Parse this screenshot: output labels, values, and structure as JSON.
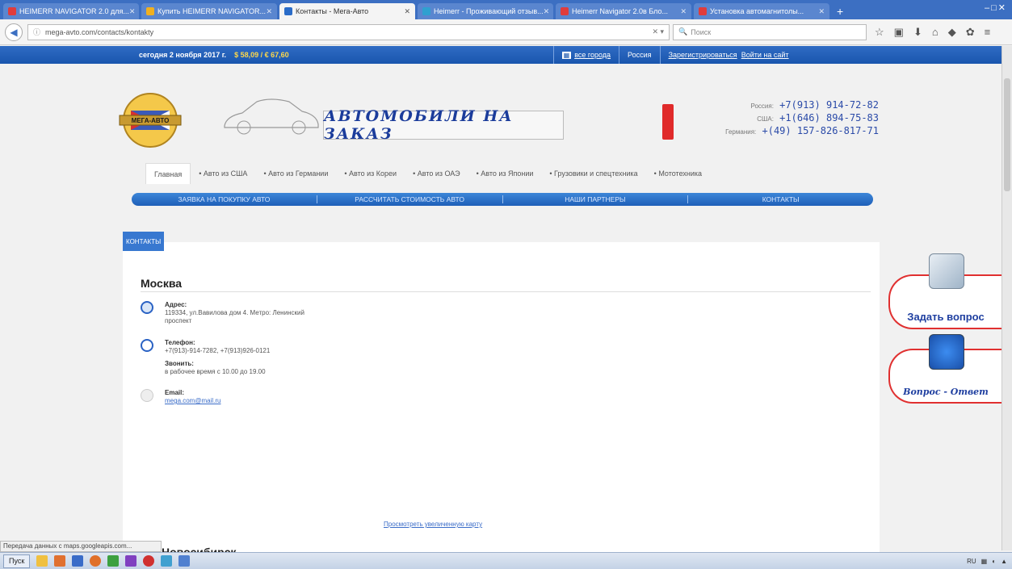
{
  "browser": {
    "tabs": [
      {
        "label": "HEIMERR NAVIGATOR 2.0 для...",
        "color": "#e03c3c",
        "active": false
      },
      {
        "label": "Купить HEIMERR NAVIGATOR...",
        "color": "#f0b020",
        "active": false
      },
      {
        "label": "Контакты - Мега-Авто",
        "color": "#2a6cc8",
        "active": true
      },
      {
        "label": "Heimerr - Проживающий отзыв...",
        "color": "#2fa0d0",
        "active": false
      },
      {
        "label": "Heimerr Navigator 2.0в Бло...",
        "color": "#e03c3c",
        "active": false
      },
      {
        "label": "Установка автомагнитолы...",
        "color": "#e03c3c",
        "active": false
      }
    ],
    "new_tab": "+",
    "url": "mega-avto.com/contacts/kontakty",
    "search_placeholder": "Поиск"
  },
  "sitebar": {
    "date": "сегодня 2 ноября 2017 г.",
    "rates": "$ 58,09 / € 67,60",
    "map_link": "все города",
    "region": "Россия",
    "register": "Зарегистрироваться",
    "login": "Войти на сайт"
  },
  "header": {
    "logo_text": "МЕГА-АВТО",
    "slogan": "АВТОМОБИЛИ НА ЗАКАЗ",
    "phones": [
      {
        "label": "Россия:",
        "number": "+7(913) 914-72-82"
      },
      {
        "label": "США:",
        "number": "+1(646) 894-75-83"
      },
      {
        "label": "Германия:",
        "number": "+(49) 157-826-817-71"
      }
    ]
  },
  "menu": [
    {
      "label": "Главная",
      "active": true
    },
    {
      "label": "• Авто из США",
      "active": false
    },
    {
      "label": "• Авто из Германии",
      "active": false
    },
    {
      "label": "• Авто из Кореи",
      "active": false
    },
    {
      "label": "• Авто из ОАЭ",
      "active": false
    },
    {
      "label": "• Авто из Японии",
      "active": false
    },
    {
      "label": "• Грузовики и спецтехника",
      "active": false
    },
    {
      "label": "• Мототехника",
      "active": false
    }
  ],
  "submenu": [
    {
      "label": "ЗАЯВКА НА ПОКУПКУ АВТО"
    },
    {
      "label": "РАССЧИТАТЬ СТОИМОСТЬ АВТО"
    },
    {
      "label": "НАШИ ПАРТНЕРЫ"
    },
    {
      "label": "КОНТАКТЫ"
    }
  ],
  "breadcrumb": "КОНТАКТЫ",
  "contacts": {
    "city": "Москва",
    "address_label": "Адрес:",
    "address": "119334, ул.Вавилова дом 4. Метро: Ленинский проспект",
    "phone_label": "Телефон:",
    "phone": "+7(913)-914-7282, +7(913)926-0121",
    "call_label": "Звонить:",
    "call_hours": "в рабочее время с 10.00 до 19.00",
    "email_label": "Email:",
    "email": "mega.com@mail.ru",
    "map_link": "Просмотреть увеличенную карту",
    "next_city": "Новосибирск"
  },
  "widgets": {
    "ask": "Задать вопрос",
    "faq": "Вопрос - Ответ"
  },
  "statusbar": "Передача данных с maps.googleapis.com...",
  "taskbar": {
    "start": "Пуск",
    "lang": "RU"
  }
}
